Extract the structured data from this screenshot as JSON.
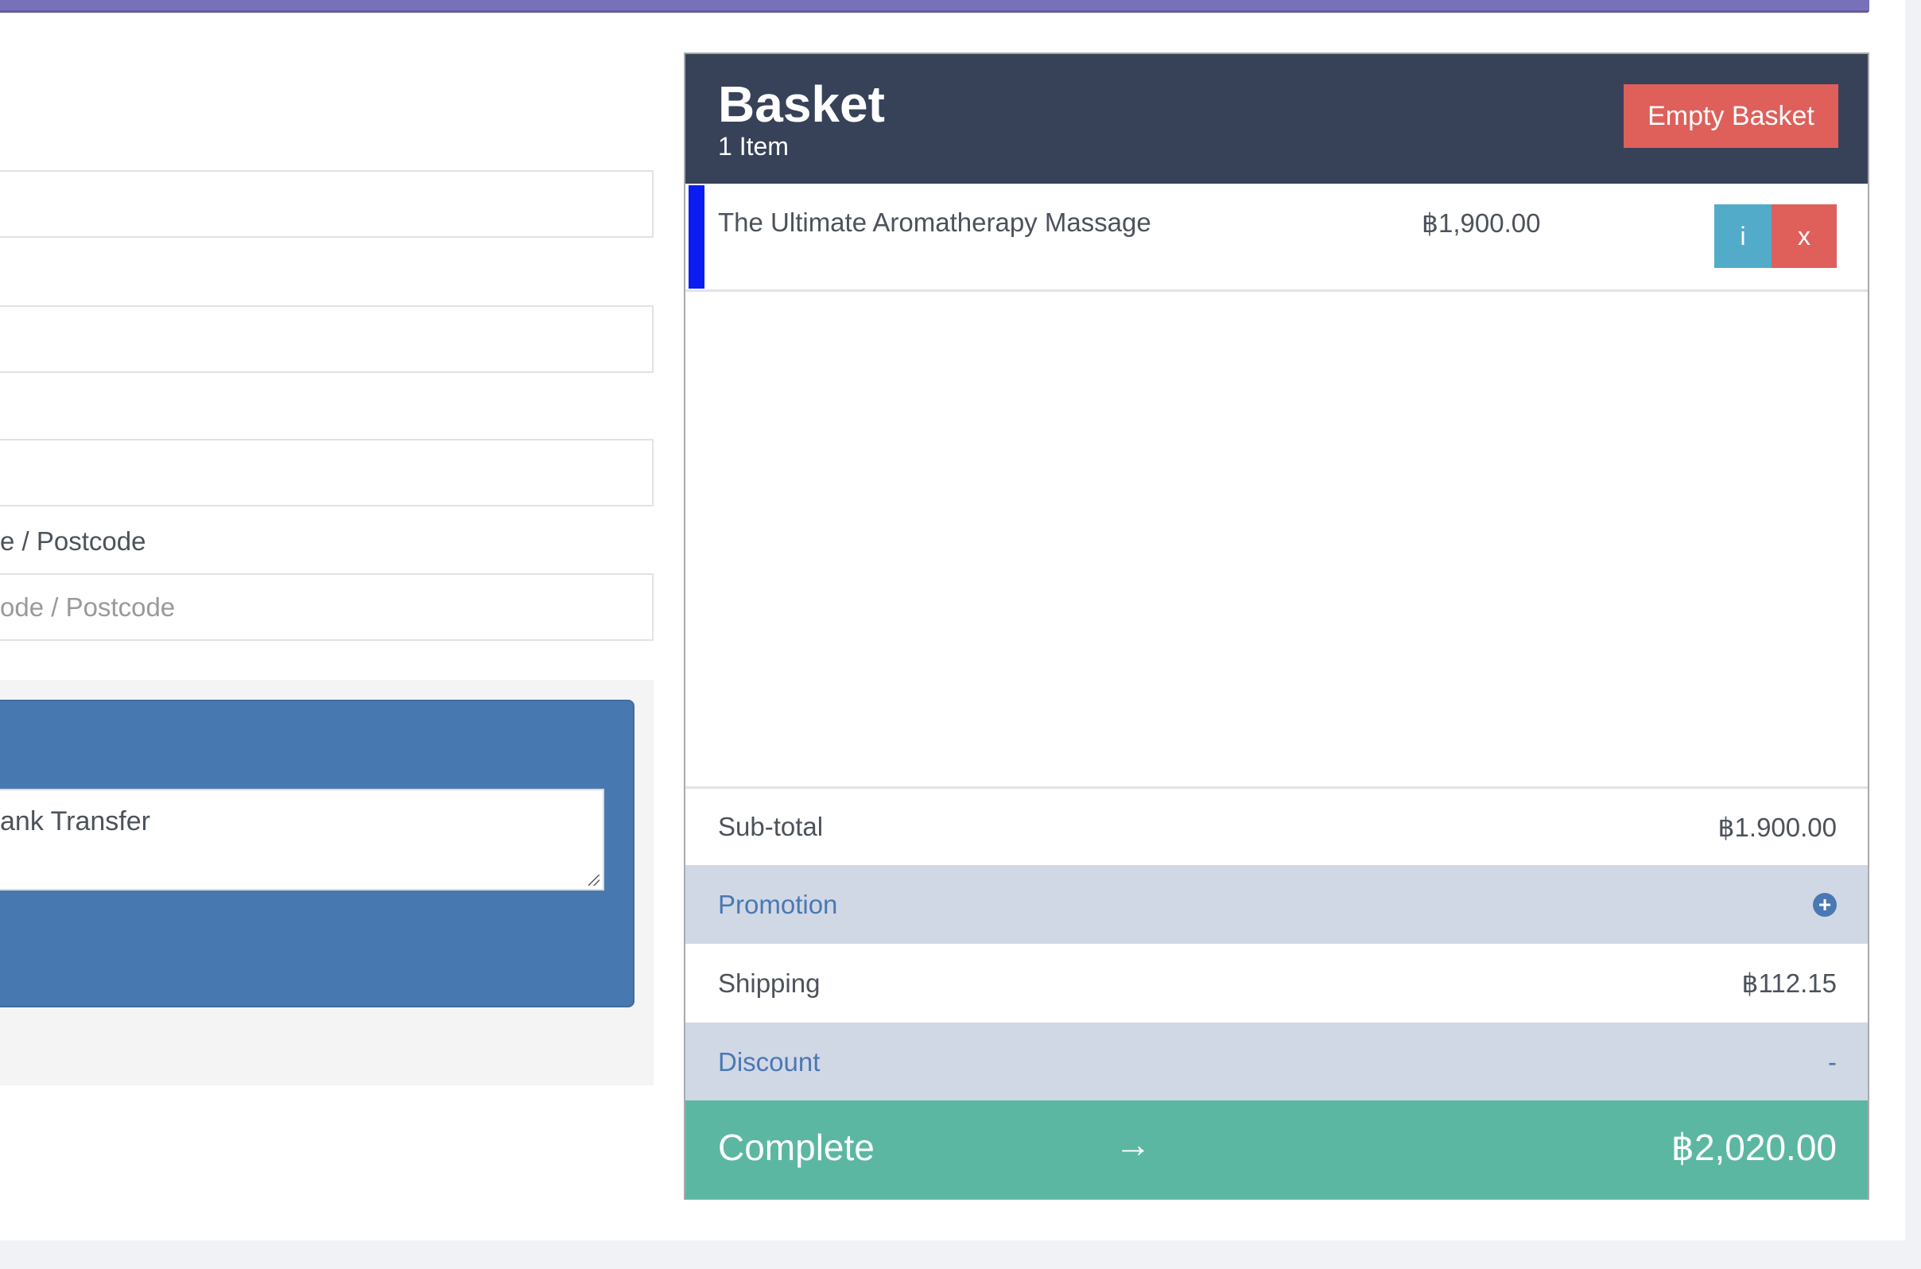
{
  "form": {
    "postcode_label": "e / Postcode",
    "postcode_placeholder": "ode / Postcode",
    "payment_method_value": "ank Transfer"
  },
  "basket": {
    "title": "Basket",
    "count": "1 Item",
    "empty_button": "Empty Basket",
    "items": [
      {
        "name": "The Ultimate Aromatherapy Massage",
        "price": "฿1,900.00",
        "info_button": "i",
        "remove_button": "x"
      }
    ],
    "summary": {
      "subtotal_label": "Sub-total",
      "subtotal_value": "฿1.900.00",
      "promotion_label": "Promotion",
      "promotion_icon": "+",
      "shipping_label": "Shipping",
      "shipping_value": "฿112.15",
      "discount_label": "Discount",
      "discount_value": "-"
    },
    "complete": {
      "label": "Complete",
      "arrow": "→",
      "total": "฿2,020.00"
    }
  },
  "colors": {
    "header": "#374259",
    "danger": "#df5f5a",
    "info": "#52acc9",
    "success": "#5cb7a2",
    "accent": "#7870b8",
    "panel": "#4779b0"
  }
}
